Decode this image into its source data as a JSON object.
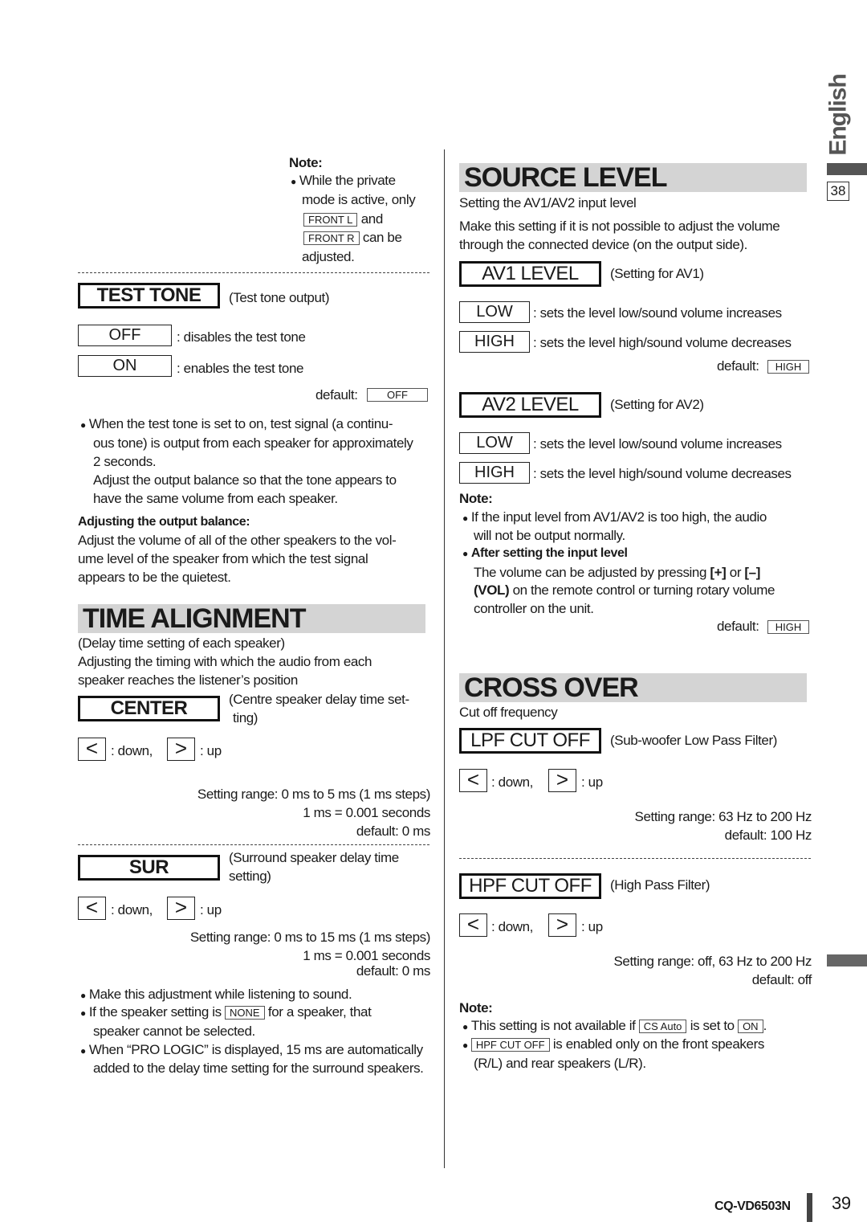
{
  "side": {
    "language": "English",
    "page_box": "38"
  },
  "footer": {
    "model": "CQ-VD6503N",
    "page": "39"
  },
  "left": {
    "note_title": "Note:",
    "note_l1": "While the private",
    "note_l2": "mode is active, only",
    "note_key1": "FRONT L",
    "note_and": "and",
    "note_key2": "FRONT R",
    "note_canbe": "can be",
    "note_l5": "adjusted.",
    "test_tone": {
      "label": "TEST TONE",
      "desc": "(Test tone output)",
      "off": "OFF",
      "off_desc": ": disables the test tone",
      "on": "ON",
      "on_desc": ": enables the test tone",
      "default_label": "default:",
      "default_value": "OFF",
      "b1": "When the test tone is set to on,  test signal (a continu-",
      "b2": "ous tone) is output from each speaker for approximately",
      "b3": "2 seconds.",
      "b4": "Adjust the output balance so that the tone appears to",
      "b5": "have the same volume from each speaker.",
      "adj_title": "Adjusting the output balance:",
      "adj1": "Adjust the volume of all of the other speakers to the vol-",
      "adj2": "ume level of the speaker from which the test signal",
      "adj3": "appears to be the quietest."
    },
    "time_alignment": {
      "title": "TIME ALIGNMENT",
      "l1": "(Delay time setting of each speaker)",
      "l2": "Adjusting the timing with which the audio from each",
      "l3": "speaker reaches the listener’s position",
      "center": {
        "label": "CENTER",
        "desc1": "(Centre speaker delay time set-",
        "desc2": "ting)",
        "down": ": down,",
        "up": ": up",
        "range": "Setting range: 0 ms to 5 ms (1 ms steps)",
        "ms": "1 ms = 0.001 seconds",
        "default": "default: 0 ms"
      },
      "sur": {
        "label": "SUR",
        "desc1": "(Surround speaker delay time",
        "desc2": "setting)",
        "down": ": down,",
        "up": ": up",
        "range": "Setting range: 0 ms to 15 ms (1 ms steps)",
        "ms": "1 ms = 0.001 seconds",
        "default": "default: 0 ms"
      },
      "n1": "Make this adjustment while listening to sound.",
      "n2a": "If the speaker setting is",
      "n2key": "NONE",
      "n2b": "for a speaker, that",
      "n2c": "speaker cannot be selected.",
      "n3a": "When “PRO LOGIC” is displayed, 15 ms are automatically",
      "n3b": "added to the delay time setting for the surround speakers."
    }
  },
  "right": {
    "source_level": {
      "title": "SOURCE LEVEL",
      "l1": "Setting the AV1/AV2 input level",
      "l2": "Make this setting if it is not possible to adjust the volume",
      "l3": "through the connected device (on the output side).",
      "av1": {
        "label": "AV1 LEVEL",
        "desc": "(Setting for AV1)",
        "low": "LOW",
        "low_desc": ": sets the level low/sound volume increases",
        "high": "HIGH",
        "high_desc": ": sets the level high/sound volume decreases",
        "default_label": "default:",
        "default_value": "HIGH"
      },
      "av2": {
        "label": "AV2 LEVEL",
        "desc": "(Setting for AV2)",
        "low": "LOW",
        "low_desc": ": sets the level low/sound volume increases",
        "high": "HIGH",
        "high_desc": ": sets the level high/sound volume decreases"
      },
      "note_title": "Note:",
      "n1a": "If the input level from AV1/AV2 is too high, the audio",
      "n1b": "will not be output normally.",
      "n2title": "After setting the input level",
      "n2a": "The volume can be adjusted by pressing",
      "n2plus": "[+]",
      "n2or": "or",
      "n2minus": "[–]",
      "n2vol": "(VOL)",
      "n2b": "on the remote control or turning rotary volume",
      "n2c": "controller on the unit.",
      "default_label": "default:",
      "default_value": "HIGH"
    },
    "cross_over": {
      "title": "CROSS OVER",
      "l1": "Cut off frequency",
      "lpf": {
        "label": "LPF CUT OFF",
        "desc": "(Sub-woofer Low Pass Filter)",
        "down": ": down,",
        "up": ": up",
        "range": "Setting range: 63 Hz to 200 Hz",
        "default": "default: 100 Hz"
      },
      "hpf": {
        "label": "HPF CUT OFF",
        "desc": "(High Pass Filter)",
        "down": ": down,",
        "up": ": up",
        "range": "Setting range: off, 63 Hz to 200 Hz",
        "default": "default: off"
      },
      "note_title": "Note:",
      "n1a": "This setting is not available if",
      "n1key": "CS Auto",
      "n1b": "is set to",
      "n1key2": "ON",
      "n1c": ".",
      "n2key": "HPF CUT OFF",
      "n2a": "is enabled only on the front speakers",
      "n2b": "(R/L) and rear speakers (L/R)."
    }
  },
  "icons": {
    "down": "<",
    "up": ">"
  }
}
